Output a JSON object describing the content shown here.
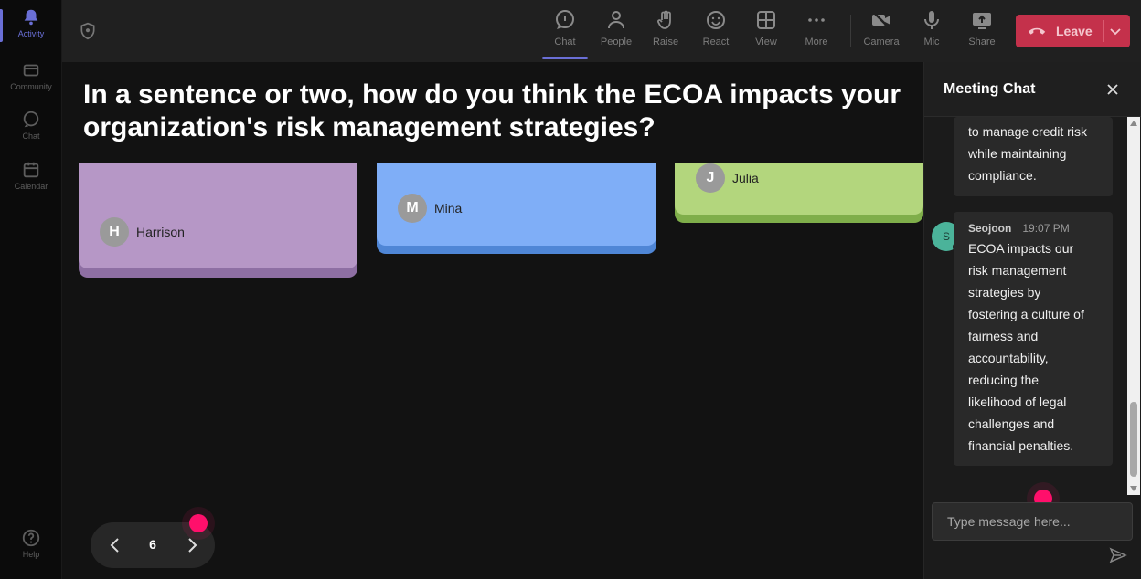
{
  "rail": {
    "items": [
      {
        "label": "Activity",
        "icon": "bell-icon"
      },
      {
        "label": "Community",
        "icon": "community-icon"
      },
      {
        "label": "Chat",
        "icon": "chat-icon"
      },
      {
        "label": "Calendar",
        "icon": "calendar-icon"
      },
      {
        "label": "Help",
        "icon": "help-icon"
      }
    ]
  },
  "toolbar": {
    "buttons": [
      {
        "label": "Chat",
        "icon": "chat-icon"
      },
      {
        "label": "People",
        "icon": "people-icon"
      },
      {
        "label": "Raise",
        "icon": "hand-icon"
      },
      {
        "label": "React",
        "icon": "smiley-icon"
      },
      {
        "label": "View",
        "icon": "grid-icon"
      },
      {
        "label": "More",
        "icon": "more-icon"
      },
      {
        "label": "Camera",
        "icon": "camera-off-icon"
      },
      {
        "label": "Mic",
        "icon": "mic-icon"
      },
      {
        "label": "Share",
        "icon": "share-icon"
      }
    ],
    "leave_label": "Leave"
  },
  "stage": {
    "question": "In a sentence or two, how do you think the ECOA impacts your organization's risk management strategies?",
    "cards": [
      {
        "initial": "H",
        "name": "Harrison",
        "color": "#b697c6",
        "shadow": "#8e6fa3"
      },
      {
        "initial": "M",
        "name": "Mina",
        "color": "#7faef7",
        "shadow": "#4f86d6"
      },
      {
        "initial": "J",
        "name": "Julia",
        "color": "#b3d67d",
        "shadow": "#7fae4a"
      }
    ],
    "page_number": "6"
  },
  "chat": {
    "title": "Meeting Chat",
    "prev_message_tail": [
      "to manage credit risk",
      "while maintaining",
      "compliance."
    ],
    "message": {
      "avatar_initial": "S",
      "sender": "Seojoon",
      "time": "19:07 PM",
      "lines": [
        "ECOA impacts our",
        "risk management",
        "strategies by",
        "fostering a culture of",
        "fairness and",
        "accountability,",
        "reducing the",
        "likelihood of legal",
        "challenges and",
        "financial penalties."
      ]
    },
    "composer_placeholder": "Type message here..."
  }
}
